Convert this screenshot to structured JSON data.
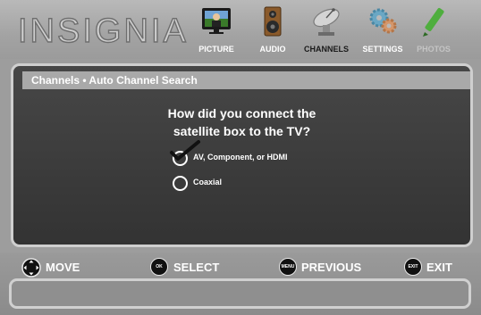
{
  "header": {
    "logo_text": "INSIGNIA",
    "menu": [
      {
        "label": "PICTURE",
        "icon": "tv-icon",
        "state": "enabled"
      },
      {
        "label": "AUDIO",
        "icon": "speaker-icon",
        "state": "enabled"
      },
      {
        "label": "CHANNELS",
        "icon": "satellite-dish-icon",
        "state": "active"
      },
      {
        "label": "SETTINGS",
        "icon": "gears-icon",
        "state": "enabled"
      },
      {
        "label": "PHOTOS",
        "icon": "pencil-icon",
        "state": "disabled"
      }
    ]
  },
  "panel": {
    "breadcrumb": "Channels • Auto Channel Search",
    "question_line1": "How did you connect the",
    "question_line2": "satellite box to the TV?",
    "options": [
      {
        "label": "AV, Component, or HDMI",
        "selected": true
      },
      {
        "label": "Coaxial",
        "selected": false
      }
    ]
  },
  "footer": {
    "hints": [
      {
        "button": "dpad-icon",
        "label": "MOVE"
      },
      {
        "button": "ok-enter-icon",
        "button_text": "OK ENTER",
        "label": "SELECT"
      },
      {
        "button": "menu-icon",
        "button_text": "MENU",
        "label": "PREVIOUS"
      },
      {
        "button": "exit-icon",
        "button_text": "EXIT",
        "label": "EXIT"
      }
    ]
  },
  "colors": {
    "background": "#9d9d9d",
    "panel": "#3d3d3d",
    "panel_border": "#cfcfcf",
    "text": "#ffffff"
  }
}
